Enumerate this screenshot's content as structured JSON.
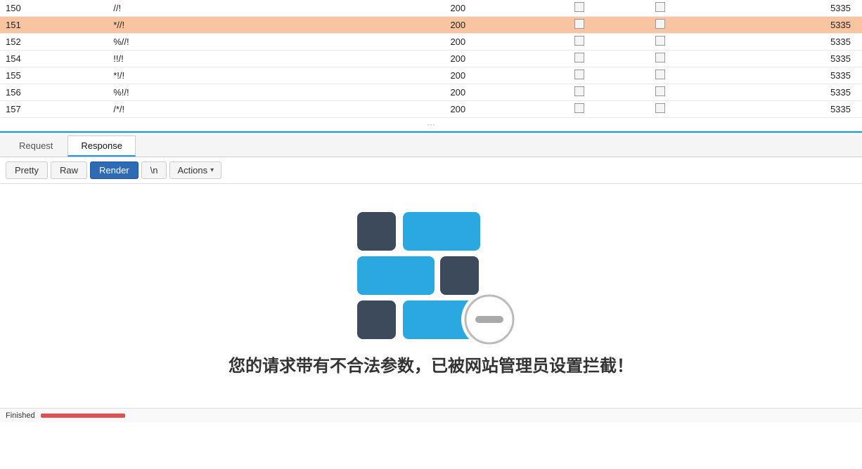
{
  "table": {
    "rows": [
      {
        "num": "150",
        "path": "//!",
        "status": "200",
        "check1": "",
        "check2": "",
        "length": "5335",
        "highlighted": false
      },
      {
        "num": "151",
        "path": "*//!",
        "status": "200",
        "check1": "",
        "check2": "",
        "length": "5335",
        "highlighted": true
      },
      {
        "num": "152",
        "path": "%//!",
        "status": "200",
        "check1": "",
        "check2": "",
        "length": "5335",
        "highlighted": false
      },
      {
        "num": "154",
        "path": "!!/!",
        "status": "200",
        "check1": "",
        "check2": "",
        "length": "5335",
        "highlighted": false
      },
      {
        "num": "155",
        "path": "*!/!",
        "status": "200",
        "check1": "",
        "check2": "",
        "length": "5335",
        "highlighted": false
      },
      {
        "num": "156",
        "path": "%!/!",
        "status": "200",
        "check1": "",
        "check2": "",
        "length": "5335",
        "highlighted": false
      },
      {
        "num": "157",
        "path": "/*/!",
        "status": "200",
        "check1": "",
        "check2": "",
        "length": "5335",
        "highlighted": false
      }
    ]
  },
  "tabs": {
    "request": "Request",
    "response": "Response",
    "active": "Response"
  },
  "toolbar": {
    "pretty": "Pretty",
    "raw": "Raw",
    "render": "Render",
    "n": "\\n",
    "actions": "Actions"
  },
  "render": {
    "blocked_text": "您的请求带有不合法参数，已被网站管理员设置拦截！"
  },
  "statusbar": {
    "label": "Finished"
  }
}
